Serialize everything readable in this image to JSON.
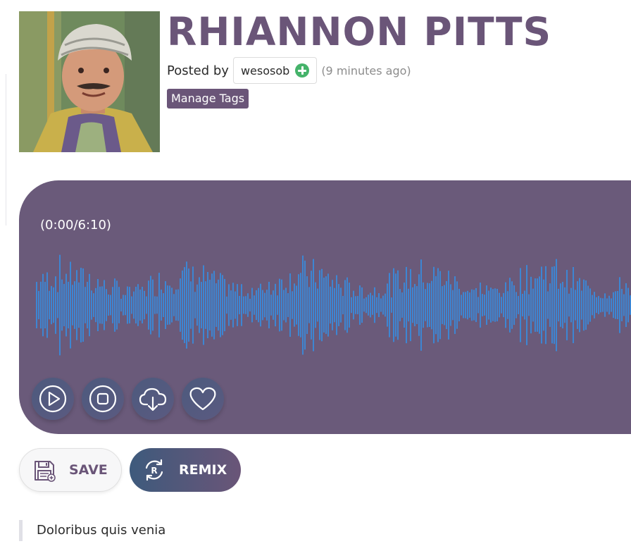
{
  "track": {
    "title": "RHIANNON PITTS",
    "posted_by_label": "Posted by",
    "username": "wesosob",
    "time_ago": "(9 minutes ago)",
    "manage_tags_label": "Manage Tags"
  },
  "player": {
    "time_display": "(0:00/6:10)",
    "controls": [
      {
        "name": "play-icon"
      },
      {
        "name": "stop-icon"
      },
      {
        "name": "cloud-download-icon"
      },
      {
        "name": "heart-icon"
      }
    ]
  },
  "actions": {
    "save_label": "SAVE",
    "remix_label": "REMIX",
    "save_icon": "floppy-disk-icon",
    "remix_icon": "remix-refresh-icon",
    "remix_icon_letter": "R"
  },
  "description": "Doloribus quis venia",
  "colors": {
    "brand_purple": "#6a5578",
    "player_bg": "#6a5a7a",
    "waveform": "#3d86d3",
    "follow_green": "#45b36a"
  }
}
